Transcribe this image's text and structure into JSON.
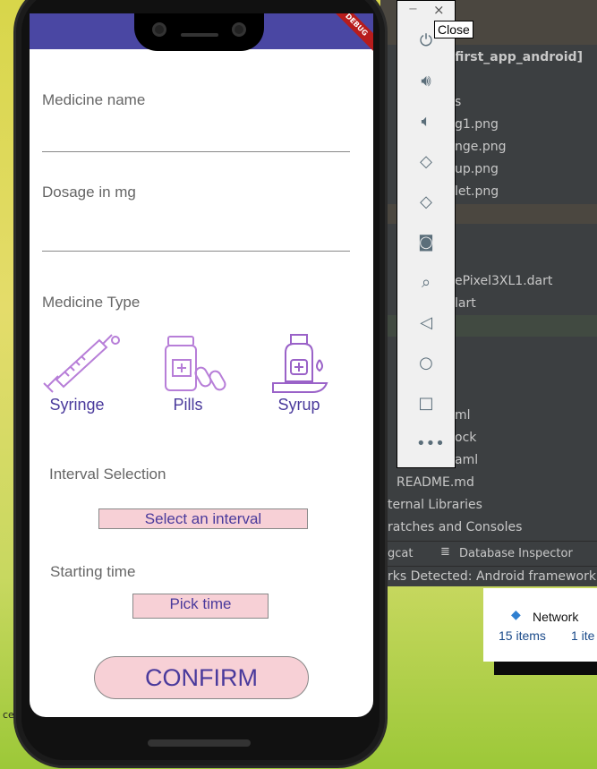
{
  "app": {
    "debug_banner": "DEBUG",
    "medicine_name_label": "Medicine name",
    "dosage_label": "Dosage in mg",
    "medicine_type_label": "Medicine Type",
    "medicine_types": [
      {
        "label": "Syringe",
        "icon": "syringe-icon"
      },
      {
        "label": "Pills",
        "icon": "pills-icon"
      },
      {
        "label": "Syrup",
        "icon": "syrup-icon"
      }
    ],
    "interval_label": "Interval Selection",
    "interval_button": "Select an interval",
    "start_label": "Starting time",
    "pick_time_button": "Pick time",
    "confirm_button": "CONFIRM",
    "colors": {
      "appbar": "#4a47a3",
      "button_bg": "#f7d0d6",
      "accent_text": "#4a3a9c"
    }
  },
  "emulator_toolbar": {
    "minimize": "−",
    "close": "×",
    "tooltip": "Close",
    "icons": [
      "power-icon",
      "volume-up-icon",
      "volume-down-icon",
      "rotate-left-icon",
      "rotate-right-icon",
      "camera-icon",
      "zoom-icon",
      "back-icon",
      "home-icon",
      "overview-icon",
      "more-icon"
    ]
  },
  "ide": {
    "project": "first_app_android]",
    "files": [
      "s",
      "g1.png",
      "nge.png",
      "up.png",
      "let.png",
      "ePixel3XL1.dart",
      "lart",
      "ml",
      "ock",
      "aml",
      "README.md",
      "ternal Libraries",
      "ratches and Consoles"
    ],
    "tabs": [
      "gcat",
      "Database Inspector"
    ],
    "status": "rks Detected: Android framework is"
  },
  "explorer": {
    "title": "Network",
    "count": "15 items",
    "selected": "1 ite"
  },
  "desktop": {
    "label": "ce"
  }
}
